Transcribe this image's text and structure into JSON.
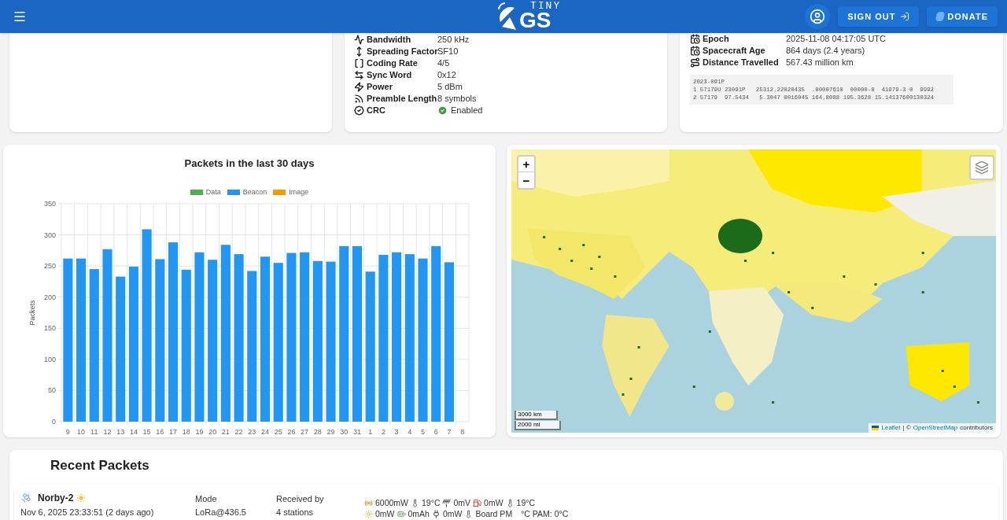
{
  "header": {
    "logo_top": "TINY",
    "logo_bottom": "GS",
    "sign_out": "SIGN OUT",
    "donate": "DONATE"
  },
  "modulation": {
    "rows": [
      {
        "kind": "bandwidth",
        "label": "Bandwidth",
        "value": "250 kHz"
      },
      {
        "kind": "spreading",
        "label": "Spreading Factor",
        "value": "SF10"
      },
      {
        "kind": "coding",
        "label": "Coding Rate",
        "value": "4/5"
      },
      {
        "kind": "sync",
        "label": "Sync Word",
        "value": "0x12"
      },
      {
        "kind": "power",
        "label": "Power",
        "value": "5 dBm"
      },
      {
        "kind": "preamble",
        "label": "Preamble Length",
        "value": "8 symbols"
      },
      {
        "kind": "crc",
        "label": "CRC",
        "value": "Enabled",
        "enabled": true
      }
    ]
  },
  "orbit": {
    "rows": [
      {
        "kind": "calendar",
        "label": "Epoch",
        "value": "2025-11-08 04:17:05 UTC"
      },
      {
        "kind": "calendar",
        "label": "Spacecraft Age",
        "value": "864 days (2.4 years)"
      },
      {
        "kind": "route",
        "label": "Distance Travelled",
        "value": "567.43 million km"
      }
    ],
    "tle": [
      "2023-091P",
      "1 57179U 23091P   25312.22020435  .00007610  00000-0  41979-3 0  9992",
      "2 57179  97.5434   5.3047 0016045 164.8088 195.3628 15.14137600130324"
    ]
  },
  "chart_data": {
    "type": "bar",
    "title": "Packets in the last 30 days",
    "ylabel": "Packets",
    "stacked": true,
    "grid": true,
    "categories": [
      "9",
      "10",
      "11",
      "12",
      "13",
      "14",
      "15",
      "16",
      "17",
      "18",
      "19",
      "20",
      "21",
      "22",
      "23",
      "24",
      "25",
      "26",
      "27",
      "28",
      "29",
      "30",
      "31",
      "1",
      "2",
      "3",
      "4",
      "5",
      "6",
      "7",
      "8"
    ],
    "ylim": [
      0,
      350
    ],
    "yticks": [
      0,
      50,
      100,
      150,
      200,
      250,
      300,
      350
    ],
    "series": [
      {
        "name": "Data",
        "color": "#4caf50",
        "values": [
          0,
          0,
          0,
          0,
          0,
          0,
          0,
          0,
          0,
          0,
          0,
          0,
          0,
          0,
          0,
          0,
          0,
          0,
          0,
          0,
          0,
          0,
          0,
          0,
          0,
          0,
          0,
          0,
          0,
          0,
          null
        ]
      },
      {
        "name": "Beacon",
        "color": "#2196f3",
        "values": [
          262,
          262,
          245,
          277,
          233,
          249,
          309,
          261,
          288,
          244,
          272,
          260,
          284,
          269,
          242,
          265,
          255,
          271,
          272,
          258,
          257,
          282,
          282,
          241,
          268,
          272,
          269,
          262,
          282,
          256,
          null
        ]
      },
      {
        "name": "Image",
        "color": "#ff9800",
        "values": [
          0,
          0,
          0,
          0,
          0,
          0,
          0,
          0,
          0,
          0,
          0,
          0,
          0,
          0,
          0,
          0,
          0,
          0,
          0,
          0,
          0,
          0,
          0,
          0,
          0,
          0,
          0,
          0,
          0,
          0,
          null
        ]
      }
    ]
  },
  "map": {
    "zoom_in": "+",
    "zoom_out": "−",
    "scale": [
      "3000 km",
      "2000 mi"
    ],
    "attribution": {
      "link": "Leaflet",
      "separator": "| ©",
      "osm": "OpenStreetMap",
      "tail": "contributors"
    }
  },
  "recent": {
    "title": "Recent Packets",
    "packets": [
      {
        "satellite": "Norby-2",
        "date": "Nov 6, 2025 23:33:51 (2 days ago)",
        "mode_label": "Mode",
        "mode": "LoRa@436.5",
        "received_label": "Received by",
        "received": "4 stations",
        "telemetry": [
          [
            {
              "kind": "radio",
              "text": "6000mW"
            },
            {
              "kind": "thermometer",
              "text": "19°C"
            },
            {
              "kind": "antenna",
              "text": "0mV"
            },
            {
              "kind": "fuel",
              "text": "0mW"
            },
            {
              "kind": "thermometer",
              "text": "19°C"
            }
          ],
          [
            {
              "kind": "sun",
              "text": "0mW"
            },
            {
              "kind": "battery",
              "text": "0mAh"
            },
            {
              "kind": "plug",
              "text": "0mW"
            },
            {
              "kind": "thermometer",
              "text": "Board PM"
            },
            {
              "kind": "none",
              "text": "°C PAM: 0°C"
            }
          ]
        ]
      }
    ]
  }
}
